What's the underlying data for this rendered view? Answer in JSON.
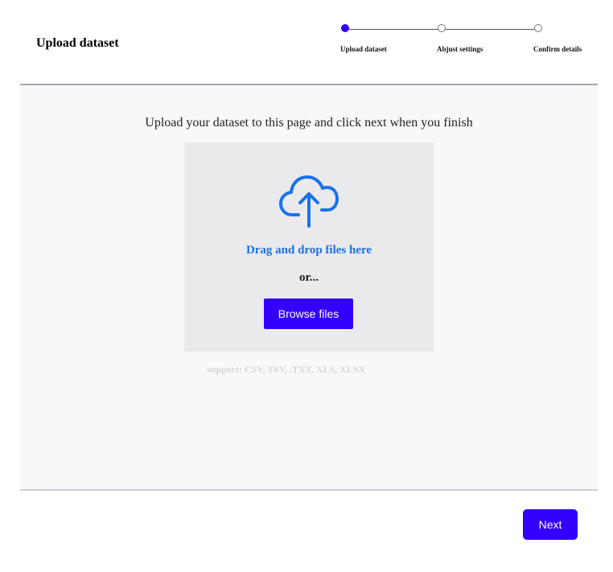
{
  "header": {
    "title": "Upload dataset"
  },
  "stepper": {
    "steps": [
      {
        "label": "Upload dataset",
        "state": "active"
      },
      {
        "label": "Abjust settings",
        "state": "inactive"
      },
      {
        "label": "Confirm details",
        "state": "inactive"
      }
    ]
  },
  "upload": {
    "instruction": "Upload your dataset to this page and click next when you finish",
    "drop_text": "Drag and drop files here",
    "or_text": "or...",
    "browse_label": "Browse files",
    "support_text": "support: CSV, TSV, .TXT, XLS, XLSX",
    "icon": "cloud-upload-icon"
  },
  "footer": {
    "next_label": "Next"
  },
  "colors": {
    "accent": "#3300ff",
    "link": "#1a73e8",
    "panel_bg": "#f8f8fa",
    "dropzone_bg": "#eaeaec"
  }
}
